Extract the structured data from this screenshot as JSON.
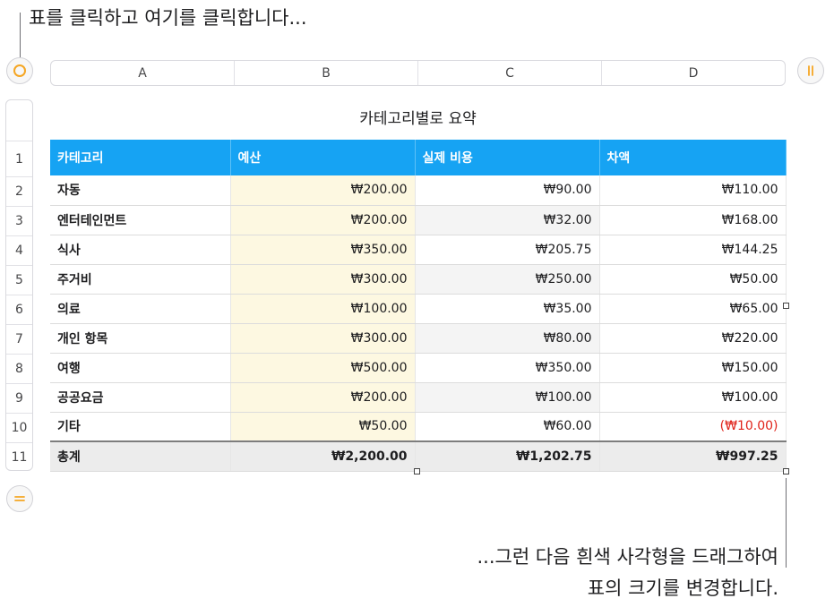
{
  "callouts": {
    "top": "표를 클릭하고 여기를 클릭합니다...",
    "bottom_line1": "...그런 다음 흰색 사각형을 드래그하여",
    "bottom_line2": "표의 크기를 변경합니다."
  },
  "table": {
    "title": "카테고리별로 요약",
    "column_letters": [
      "A",
      "B",
      "C",
      "D"
    ],
    "row_numbers": [
      "1",
      "2",
      "3",
      "4",
      "5",
      "6",
      "7",
      "8",
      "9",
      "10",
      "11"
    ],
    "headers": [
      "카테고리",
      "예산",
      "실제 비용",
      "차액"
    ],
    "rows": [
      [
        "자동",
        "₩200.00",
        "₩90.00",
        "₩110.00"
      ],
      [
        "엔터테인먼트",
        "₩200.00",
        "₩32.00",
        "₩168.00"
      ],
      [
        "식사",
        "₩350.00",
        "₩205.75",
        "₩144.25"
      ],
      [
        "주거비",
        "₩300.00",
        "₩250.00",
        "₩50.00"
      ],
      [
        "의료",
        "₩100.00",
        "₩35.00",
        "₩65.00"
      ],
      [
        "개인 항목",
        "₩300.00",
        "₩80.00",
        "₩220.00"
      ],
      [
        "여행",
        "₩500.00",
        "₩350.00",
        "₩150.00"
      ],
      [
        "공공요금",
        "₩200.00",
        "₩100.00",
        "₩100.00"
      ],
      [
        "기타",
        "₩50.00",
        "₩60.00",
        "(₩10.00)"
      ]
    ],
    "total": [
      "총계",
      "₩2,200.00",
      "₩1,202.75",
      "₩997.25"
    ]
  },
  "icons": {
    "table_select": "circle-select-icon",
    "column_handle": "column-resize-icon",
    "row_handle": "row-resize-icon"
  },
  "colors": {
    "header_bg": "#16a3f3",
    "accent": "#f5a623",
    "negative": "#e0231a",
    "budget_fill": "#fdf8e1"
  }
}
